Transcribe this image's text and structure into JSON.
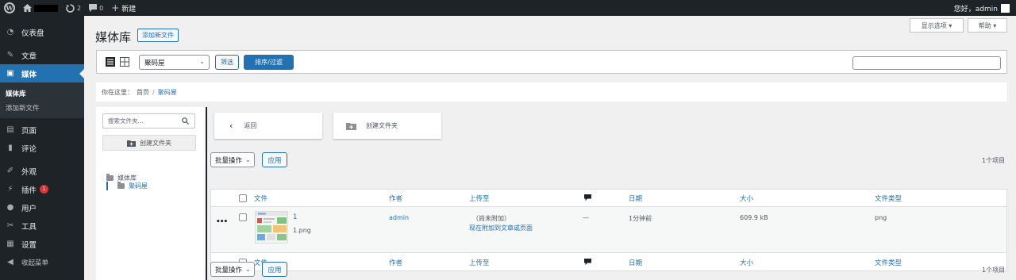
{
  "adminbar": {
    "updates_count": "2",
    "comments_count": "0",
    "new_label": "新建",
    "greeting": "您好，admin"
  },
  "sidebar": {
    "items": [
      {
        "label": "仪表盘",
        "icon": "dashboard-icon"
      },
      {
        "label": "文章",
        "icon": "pin-icon"
      },
      {
        "label": "媒体",
        "icon": "media-icon"
      },
      {
        "label": "页面",
        "icon": "page-icon"
      },
      {
        "label": "评论",
        "icon": "comment-icon"
      },
      {
        "label": "外观",
        "icon": "brush-icon"
      },
      {
        "label": "插件",
        "icon": "plugin-icon",
        "badge": "1"
      },
      {
        "label": "用户",
        "icon": "user-icon"
      },
      {
        "label": "工具",
        "icon": "wrench-icon"
      },
      {
        "label": "设置",
        "icon": "settings-icon"
      },
      {
        "label": "收起菜单",
        "icon": "collapse-icon"
      }
    ],
    "submenu": [
      "媒体库",
      "添加新文件"
    ]
  },
  "header": {
    "title": "媒体库",
    "add_new": "添加新文件",
    "screen_options": "显示选项 ▾",
    "help": "帮助 ▾"
  },
  "toolbar": {
    "folder_select": "聚码屋",
    "filter_button": "筛选",
    "sort_filter_button": "排序/过滤",
    "search_value": ""
  },
  "breadcrumb": {
    "prefix": "你在这里：",
    "home": "首页",
    "separator": "/",
    "current": "聚码屋"
  },
  "folders": {
    "search_placeholder": "搜索文件夹...",
    "create_button": "创建文件夹",
    "tree_root": "媒体库",
    "tree_child": "聚码屋"
  },
  "actions": {
    "back": "返回",
    "create_folder": "创建文件夹"
  },
  "bulk": {
    "label": "批量操作",
    "apply": "应用",
    "count": "1个项目"
  },
  "table": {
    "columns": [
      "文件",
      "作者",
      "上传至",
      "日期",
      "大小",
      "文件类型"
    ],
    "row": {
      "title": "1",
      "filename": "1.png",
      "author": "admin",
      "attached": "（尚未附加）",
      "attach_link": "现在附加到文章或页面",
      "comments": "—",
      "date": "1分钟前",
      "size": "609.9 kB",
      "type": "png",
      "row_actions": "•••"
    }
  },
  "colors": {
    "accent": "#2271b1",
    "sidebar_bg": "#1d2327",
    "badge": "#d63638"
  }
}
